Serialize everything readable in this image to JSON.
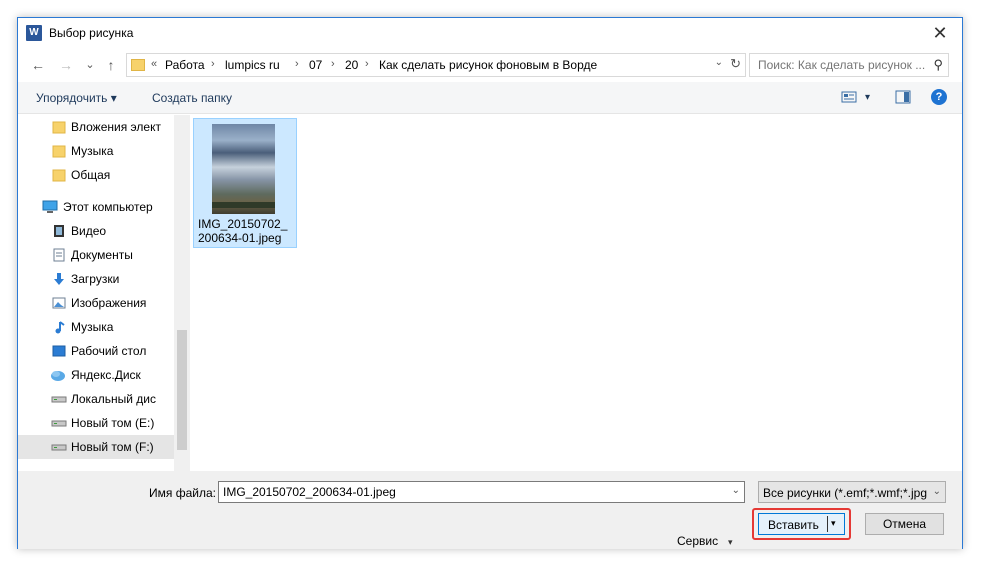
{
  "window": {
    "title": "Выбор рисунка",
    "app_icon_letter": "W",
    "close_glyph": "✕"
  },
  "nav": {
    "back": "←",
    "forward": "→",
    "recent": "⌄",
    "up": "↑"
  },
  "address": {
    "overflow": "«",
    "crumbs": [
      "Работа",
      "lumpics ru",
      "07",
      "20",
      "Как сделать рисунок фоновым в Ворде"
    ],
    "separator": "›",
    "dropdown": "⌄",
    "refresh": "↻"
  },
  "search": {
    "placeholder": "Поиск: Как сделать рисунок ..."
  },
  "toolbar": {
    "organize": "Упорядочить ▾",
    "new_folder": "Создать папку",
    "view_dropdown": "▾",
    "help": "?"
  },
  "sidebar": {
    "items": [
      {
        "label": "Вложения элект",
        "icon": "folder-icon"
      },
      {
        "label": "Музыка",
        "icon": "folder-icon"
      },
      {
        "label": "Общая",
        "icon": "folder-icon"
      },
      {
        "label": "Этот компьютер",
        "icon": "computer-icon"
      },
      {
        "label": "Видео",
        "icon": "video-icon"
      },
      {
        "label": "Документы",
        "icon": "documents-icon"
      },
      {
        "label": "Загрузки",
        "icon": "downloads-icon"
      },
      {
        "label": "Изображения",
        "icon": "pictures-icon"
      },
      {
        "label": "Музыка",
        "icon": "music-icon"
      },
      {
        "label": "Рабочий стол",
        "icon": "desktop-icon"
      },
      {
        "label": "Яндекс.Диск",
        "icon": "yandex-disk-icon"
      },
      {
        "label": "Локальный дис",
        "icon": "drive-icon"
      },
      {
        "label": "Новый том (E:)",
        "icon": "drive-icon"
      },
      {
        "label": "Новый том (F:)",
        "icon": "drive-icon"
      }
    ]
  },
  "content": {
    "files": [
      {
        "name": "IMG_20150702_200634-01.jpeg"
      }
    ]
  },
  "footer": {
    "filename_label": "Имя файла:",
    "filename_value": "IMG_20150702_200634-01.jpeg",
    "filter_value": "Все рисунки (*.emf;*.wmf;*.jpg",
    "service_label": "Сервис",
    "service_arrow": "▾",
    "insert_label": "Вставить",
    "insert_arrow": "▾",
    "cancel_label": "Отмена",
    "chevron": "⌄"
  },
  "colors": {
    "accent": "#0078d7",
    "highlight_outline": "#e53935",
    "selection": "#cce8ff",
    "folder": "#f7d26b"
  }
}
